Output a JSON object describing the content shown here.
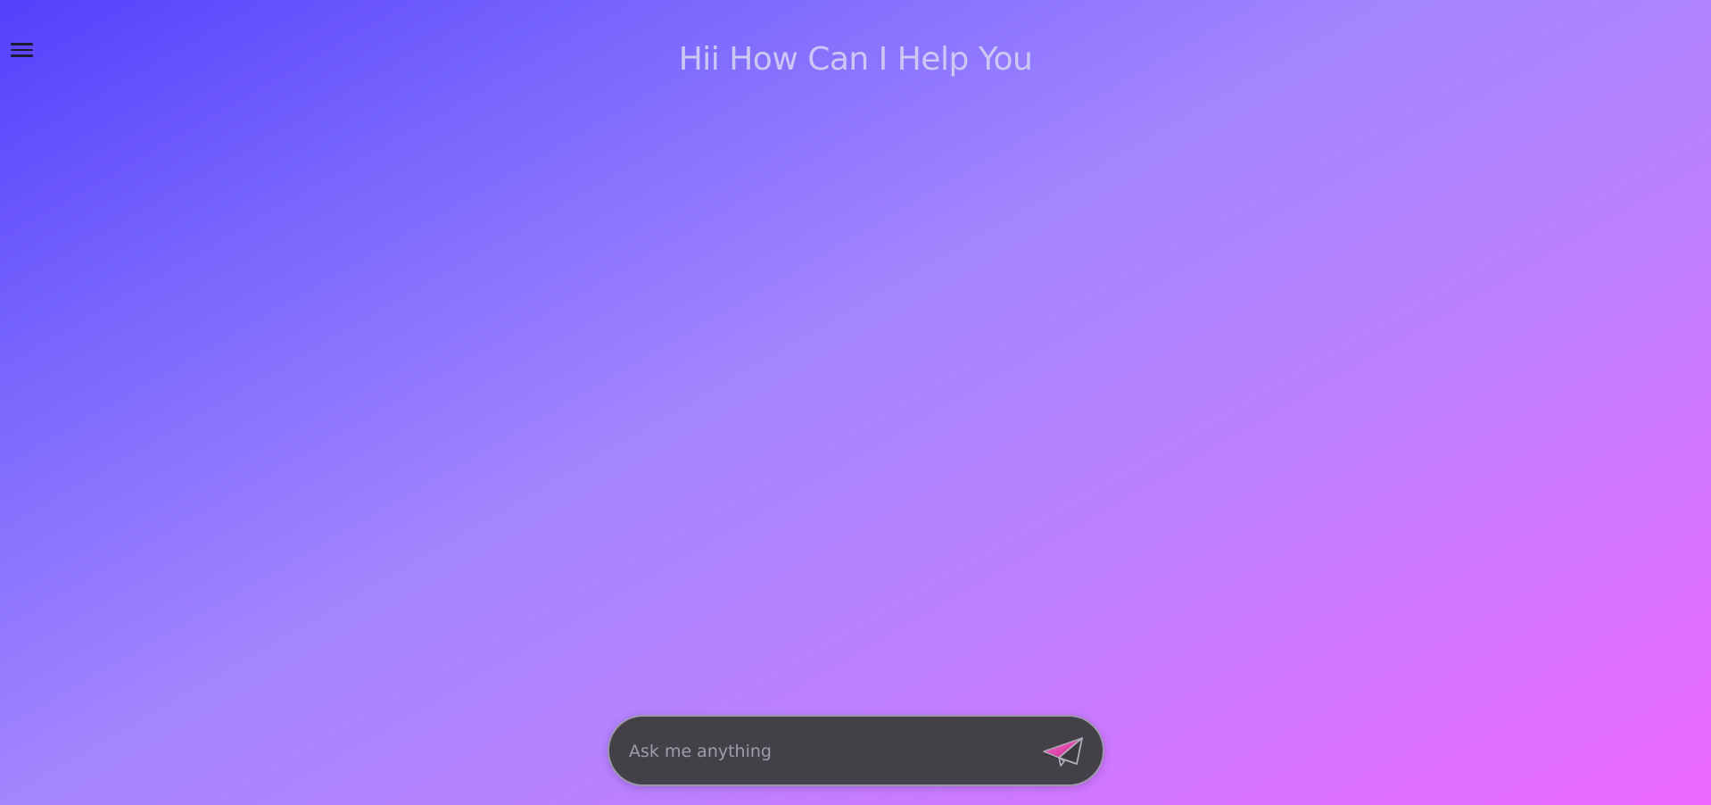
{
  "header": {
    "menu_icon": "hamburger-menu-icon",
    "title": "Hii How Can I Help You"
  },
  "chat": {
    "input_placeholder": "Ask me anything",
    "input_value": "",
    "send_icon": "paper-plane-send-icon"
  },
  "colors": {
    "gradient_start": "#5540fb",
    "gradient_mid": "#a385fe",
    "gradient_end": "#ec68fd",
    "title_text": "#cbc8f4",
    "chat_bar_bg": "#434048",
    "chat_bar_border": "#9d97ad",
    "placeholder_text": "#a09cab",
    "send_icon_accent": "#e8359f"
  }
}
